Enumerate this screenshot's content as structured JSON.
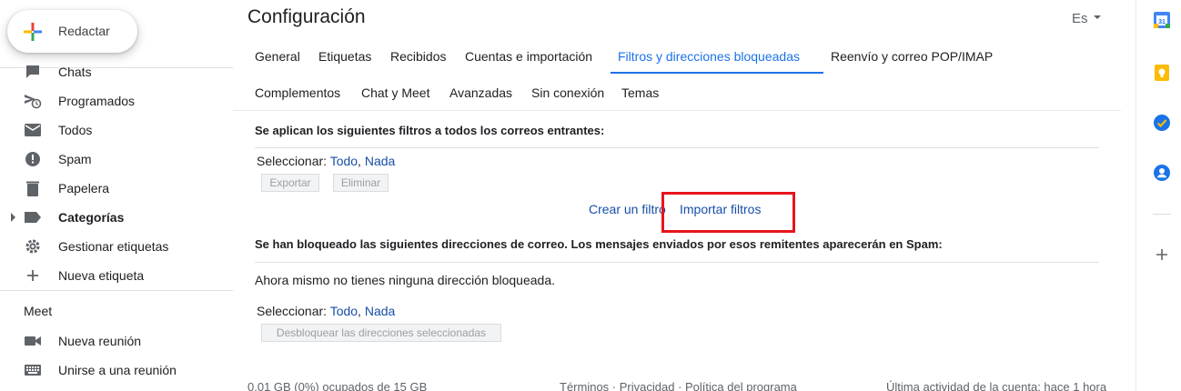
{
  "compose": {
    "label": "Redactar"
  },
  "sidebar": {
    "items": [
      {
        "label": "Chats",
        "icon": "chat-icon"
      },
      {
        "label": "Programados",
        "icon": "scheduled-icon"
      },
      {
        "label": "Todos",
        "icon": "all-mail-icon"
      },
      {
        "label": "Spam",
        "icon": "spam-icon"
      },
      {
        "label": "Papelera",
        "icon": "trash-icon"
      },
      {
        "label": "Categorías",
        "icon": "label-icon"
      },
      {
        "label": "Gestionar etiquetas",
        "icon": "gear-icon"
      },
      {
        "label": "Nueva etiqueta",
        "icon": "plus-icon"
      }
    ],
    "meet_heading": "Meet",
    "meet_items": [
      {
        "label": "Nueva reunión",
        "icon": "video-camera-icon"
      },
      {
        "label": "Unirse a una reunión",
        "icon": "keyboard-icon"
      }
    ]
  },
  "header": {
    "title": "Configuración",
    "lang": "Es"
  },
  "tabs": [
    {
      "label": "General"
    },
    {
      "label": "Etiquetas"
    },
    {
      "label": "Recibidos"
    },
    {
      "label": "Cuentas e importación"
    },
    {
      "label": "Filtros y direcciones bloqueadas",
      "active": true
    },
    {
      "label": "Reenvío y correo POP/IMAP"
    },
    {
      "label": "Complementos"
    },
    {
      "label": "Chat y Meet"
    },
    {
      "label": "Avanzadas"
    },
    {
      "label": "Sin conexión"
    },
    {
      "label": "Temas"
    }
  ],
  "filters": {
    "heading": "Se aplican los siguientes filtros a todos los correos entrantes:",
    "select_label": "Seleccionar:",
    "select_all": "Todo",
    "select_none": "Nada",
    "export_button": "Exportar",
    "delete_button": "Eliminar",
    "create_filter": "Crear un filtro",
    "import_filters": "Importar filtros"
  },
  "blocked": {
    "heading": "Se han bloqueado las siguientes direcciones de correo. Los mensajes enviados por esos remitentes aparecerán en Spam:",
    "empty_message": "Ahora mismo no tienes ninguna dirección bloqueada.",
    "select_label": "Seleccionar:",
    "select_all": "Todo",
    "select_none": "Nada",
    "unblock_button": "Desbloquear las direcciones seleccionadas"
  },
  "footer": {
    "storage": "0,01 GB (0%) ocupados de 15 GB",
    "terms": "Términos",
    "privacy": "Privacidad",
    "policy": "Política del programa",
    "last_activity": "Última actividad de la cuenta: hace 1 hora"
  },
  "colors": {
    "accent": "#1a73e8",
    "link": "#174ea6",
    "highlight": "#e8141b"
  }
}
